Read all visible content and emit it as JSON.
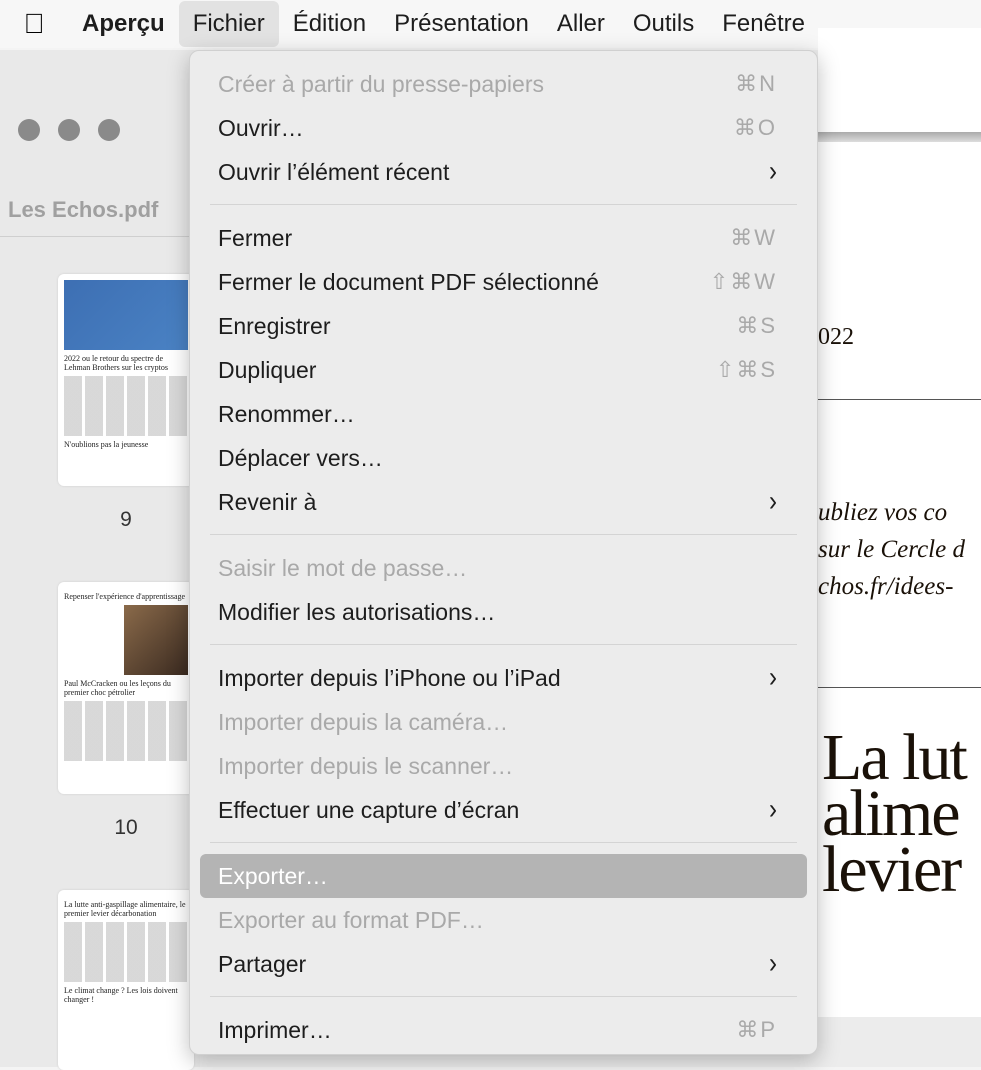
{
  "menubar": {
    "apple": "",
    "app": "Aperçu",
    "items": [
      "Fichier",
      "Édition",
      "Présentation",
      "Aller",
      "Outils",
      "Fenêtre"
    ]
  },
  "window": {
    "title": "Les Echos.pdf"
  },
  "thumbnails": [
    {
      "page": "9",
      "headline": "2022 ou le retour du spectre de Lehman Brothers sur les cryptos",
      "sub": "N'oublions pas la jeunesse"
    },
    {
      "page": "10",
      "headline": "Repenser l'expérience d'apprentissage",
      "sub": "Paul McCracken ou les leçons du premier choc pétrolier"
    },
    {
      "page": "",
      "headline": "La lutte anti-gaspillage alimentaire, le premier levier décarbonation",
      "sub": "Le climat change ? Les lois doivent changer !"
    }
  ],
  "document": {
    "date_fragment": "022",
    "italic_lines": [
      "ubliez vos co",
      "sur le Cercle d",
      "chos.fr/idees-"
    ],
    "headline_lines": [
      "La lut",
      "alime",
      "levier"
    ]
  },
  "menu": {
    "groups": [
      [
        {
          "label": "Créer à partir du presse-papiers",
          "shortcut": "⌘N",
          "disabled": true
        },
        {
          "label": "Ouvrir…",
          "shortcut": "⌘O"
        },
        {
          "label": "Ouvrir l’élément récent",
          "submenu": true
        }
      ],
      [
        {
          "label": "Fermer",
          "shortcut": "⌘W"
        },
        {
          "label": "Fermer le document PDF sélectionné",
          "shortcut": "⇧⌘W"
        },
        {
          "label": "Enregistrer",
          "shortcut": "⌘S"
        },
        {
          "label": "Dupliquer",
          "shortcut": "⇧⌘S"
        },
        {
          "label": "Renommer…"
        },
        {
          "label": "Déplacer vers…"
        },
        {
          "label": "Revenir à",
          "submenu": true
        }
      ],
      [
        {
          "label": "Saisir le mot de passe…",
          "disabled": true
        },
        {
          "label": "Modifier les autorisations…"
        }
      ],
      [
        {
          "label": "Importer depuis l’iPhone ou l’iPad",
          "submenu": true
        },
        {
          "label": "Importer depuis la caméra…",
          "disabled": true
        },
        {
          "label": "Importer depuis le scanner…",
          "disabled": true
        },
        {
          "label": "Effectuer une capture d’écran",
          "submenu": true
        }
      ],
      [
        {
          "label": "Exporter…",
          "highlighted": true
        },
        {
          "label": "Exporter au format PDF…",
          "disabled": true
        },
        {
          "label": "Partager",
          "submenu": true
        }
      ],
      [
        {
          "label": "Imprimer…",
          "shortcut": "⌘P"
        }
      ]
    ]
  }
}
